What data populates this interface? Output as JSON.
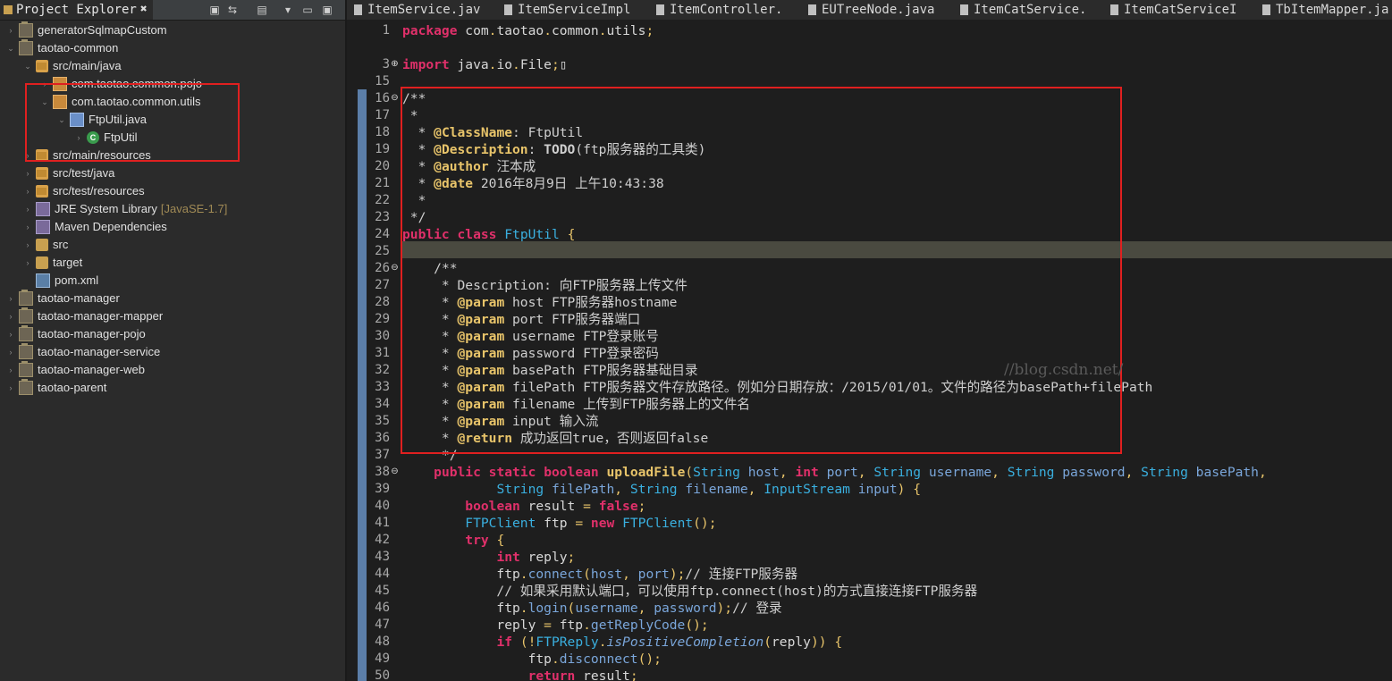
{
  "explorer": {
    "title": "Project Explorer",
    "close": "✖",
    "tree": [
      {
        "label": "generatorSqlmapCustom",
        "indent": 0,
        "icon": "project",
        "twisty": "›"
      },
      {
        "label": "taotao-common",
        "indent": 0,
        "icon": "project",
        "twisty": "⌄"
      },
      {
        "label": "src/main/java",
        "indent": 1,
        "icon": "srcfolder",
        "twisty": "⌄"
      },
      {
        "label": "com.taotao.common.pojo",
        "indent": 2,
        "icon": "package",
        "twisty": "›"
      },
      {
        "label": "com.taotao.common.utils",
        "indent": 2,
        "icon": "package",
        "twisty": "⌄"
      },
      {
        "label": "FtpUtil.java",
        "indent": 3,
        "icon": "java",
        "twisty": "⌄"
      },
      {
        "label": "FtpUtil",
        "indent": 4,
        "icon": "class",
        "twisty": "›"
      },
      {
        "label": "src/main/resources",
        "indent": 1,
        "icon": "srcfolder",
        "twisty": "›"
      },
      {
        "label": "src/test/java",
        "indent": 1,
        "icon": "srcfolder",
        "twisty": "›"
      },
      {
        "label": "src/test/resources",
        "indent": 1,
        "icon": "srcfolder",
        "twisty": "›"
      },
      {
        "label": "JRE System Library",
        "extra": "[JavaSE-1.7]",
        "indent": 1,
        "icon": "lib",
        "twisty": "›"
      },
      {
        "label": "Maven Dependencies",
        "indent": 1,
        "icon": "lib",
        "twisty": "›"
      },
      {
        "label": "src",
        "indent": 1,
        "icon": "folder",
        "twisty": "›"
      },
      {
        "label": "target",
        "indent": 1,
        "icon": "folder",
        "twisty": "›"
      },
      {
        "label": "pom.xml",
        "indent": 1,
        "icon": "xml",
        "twisty": ""
      },
      {
        "label": "taotao-manager",
        "indent": 0,
        "icon": "project",
        "twisty": "›"
      },
      {
        "label": "taotao-manager-mapper",
        "indent": 0,
        "icon": "project",
        "twisty": "›"
      },
      {
        "label": "taotao-manager-pojo",
        "indent": 0,
        "icon": "project",
        "twisty": "›"
      },
      {
        "label": "taotao-manager-service",
        "indent": 0,
        "icon": "project",
        "twisty": "›"
      },
      {
        "label": "taotao-manager-web",
        "indent": 0,
        "icon": "project",
        "twisty": "›"
      },
      {
        "label": "taotao-parent",
        "indent": 0,
        "icon": "project",
        "twisty": "›"
      }
    ]
  },
  "editor": {
    "tabs": [
      "ItemService.jav",
      "ItemServiceImpl",
      "ItemController.",
      "EUTreeNode.java",
      "ItemCatService.",
      "ItemCatServiceI",
      "TbItemMapper.ja"
    ],
    "watermark": "//blog.csdn.net/",
    "lines": [
      {
        "n": "1",
        "html": "<span class=\"kw\">package</span> com<span class=\"punc\">.</span>taotao<span class=\"punc\">.</span>common<span class=\"punc\">.</span>utils<span class=\"punc\">;</span>"
      },
      {
        "n": "",
        "html": ""
      },
      {
        "n": "3",
        "fold": "⊕",
        "html": "<span class=\"kw\">import</span> java<span class=\"punc\">.</span>io<span class=\"punc\">.</span>File<span class=\"punc\">;</span>▯"
      },
      {
        "n": "15",
        "html": ""
      },
      {
        "n": "16",
        "fold": "⊖",
        "html": "<span class=\"cm\">/**</span>"
      },
      {
        "n": "17",
        "html": "<span class=\"cm\"> *</span>"
      },
      {
        "n": "18",
        "html": "<span class=\"cm\">  * </span><span class=\"tag\">@ClassName</span><span class=\"cm\">: FtpUtil</span>"
      },
      {
        "n": "19",
        "html": "<span class=\"cm\">  * </span><span class=\"tag\">@Description</span><span class=\"cm\">: <b>TODO</b>(ftp服务器的工具类)</span>"
      },
      {
        "n": "20",
        "html": "<span class=\"cm\">  * </span><span class=\"tag\">@author</span><span class=\"cm\"> 汪本成</span>"
      },
      {
        "n": "21",
        "html": "<span class=\"cm\">  * </span><span class=\"tag\">@date</span><span class=\"cm\"> 2016年8月9日 上午10:43:38</span>"
      },
      {
        "n": "22",
        "html": "<span class=\"cm\">  *</span>"
      },
      {
        "n": "23",
        "html": "<span class=\"cm\"> */</span>"
      },
      {
        "n": "24",
        "html": "<span class=\"kw\">public</span> <span class=\"kw\">class</span> <span class=\"type\">FtpUtil</span> <span class=\"punc\">{</span>"
      },
      {
        "n": "25",
        "html": ""
      },
      {
        "n": "26",
        "fold": "⊖",
        "html": "    <span class=\"cm\">/**</span>"
      },
      {
        "n": "27",
        "html": "<span class=\"cm\">     * Description: 向FTP服务器上传文件</span>"
      },
      {
        "n": "28",
        "html": "<span class=\"cm\">     * </span><span class=\"tag\">@param</span><span class=\"cm\"> host FTP服务器hostname</span>"
      },
      {
        "n": "29",
        "html": "<span class=\"cm\">     * </span><span class=\"tag\">@param</span><span class=\"cm\"> port FTP服务器端口</span>"
      },
      {
        "n": "30",
        "html": "<span class=\"cm\">     * </span><span class=\"tag\">@param</span><span class=\"cm\"> username FTP登录账号</span>"
      },
      {
        "n": "31",
        "html": "<span class=\"cm\">     * </span><span class=\"tag\">@param</span><span class=\"cm\"> password FTP登录密码</span>"
      },
      {
        "n": "32",
        "html": "<span class=\"cm\">     * </span><span class=\"tag\">@param</span><span class=\"cm\"> basePath FTP服务器基础目录</span>"
      },
      {
        "n": "33",
        "html": "<span class=\"cm\">     * </span><span class=\"tag\">@param</span><span class=\"cm\"> filePath FTP服务器文件存放路径。例如分日期存放：/2015/01/01。文件的路径为basePath+filePath</span>"
      },
      {
        "n": "34",
        "html": "<span class=\"cm\">     * </span><span class=\"tag\">@param</span><span class=\"cm\"> filename 上传到FTP服务器上的文件名</span>"
      },
      {
        "n": "35",
        "html": "<span class=\"cm\">     * </span><span class=\"tag\">@param</span><span class=\"cm\"> input 输入流</span>"
      },
      {
        "n": "36",
        "html": "<span class=\"cm\">     * </span><span class=\"tag\">@return</span><span class=\"cm\"> 成功返回true，否则返回false</span>"
      },
      {
        "n": "37",
        "html": "<span class=\"cm\">     */</span>"
      },
      {
        "n": "38",
        "fold": "⊖",
        "html": "    <span class=\"kw\">public</span> <span class=\"kw\">static</span> <span class=\"kw\">boolean</span> <span class=\"method\">uploadFile</span><span class=\"punc\">(</span><span class=\"type\">String</span> <span class=\"param\">host</span><span class=\"punc\">,</span> <span class=\"kw\">int</span> <span class=\"param\">port</span><span class=\"punc\">,</span> <span class=\"type\">String</span> <span class=\"param\">username</span><span class=\"punc\">,</span> <span class=\"type\">String</span> <span class=\"param\">password</span><span class=\"punc\">,</span> <span class=\"type\">String</span> <span class=\"param\">basePath</span><span class=\"punc\">,</span>"
      },
      {
        "n": "39",
        "html": "            <span class=\"type\">String</span> <span class=\"param\">filePath</span><span class=\"punc\">,</span> <span class=\"type\">String</span> <span class=\"param\">filename</span><span class=\"punc\">,</span> <span class=\"type\">InputStream</span> <span class=\"param\">input</span><span class=\"punc\">)</span> <span class=\"punc\">{</span>"
      },
      {
        "n": "40",
        "html": "        <span class=\"kw\">boolean</span> result <span class=\"punc\">=</span> <span class=\"kw\">false</span><span class=\"punc\">;</span>"
      },
      {
        "n": "41",
        "html": "        <span class=\"type\">FTPClient</span> ftp <span class=\"punc\">=</span> <span class=\"kw\">new</span> <span class=\"type\">FTPClient</span><span class=\"punc\">();</span>"
      },
      {
        "n": "42",
        "html": "        <span class=\"kw\">try</span> <span class=\"punc\">{</span>"
      },
      {
        "n": "43",
        "html": "            <span class=\"kw\">int</span> reply<span class=\"punc\">;</span>"
      },
      {
        "n": "44",
        "html": "            ftp<span class=\"punc\">.</span><span class=\"param\">connect</span><span class=\"punc\">(</span><span class=\"param\">host</span><span class=\"punc\">,</span> <span class=\"param\">port</span><span class=\"punc\">);</span><span class=\"cm\">// 连接FTP服务器</span>"
      },
      {
        "n": "45",
        "html": "<span class=\"cm\">            // 如果采用默认端口，可以使用ftp.connect(host)的方式直接连接FTP服务器</span>"
      },
      {
        "n": "46",
        "html": "            ftp<span class=\"punc\">.</span><span class=\"param\">login</span><span class=\"punc\">(</span><span class=\"param\">username</span><span class=\"punc\">,</span> <span class=\"param\">password</span><span class=\"punc\">);</span><span class=\"cm\">// 登录</span>"
      },
      {
        "n": "47",
        "html": "            reply <span class=\"punc\">=</span> ftp<span class=\"punc\">.</span><span class=\"param\">getReplyCode</span><span class=\"punc\">();</span>"
      },
      {
        "n": "48",
        "html": "            <span class=\"kw\">if</span> <span class=\"punc\">(!</span><span class=\"type\">FTPReply</span><span class=\"punc\">.</span><span class=\"param italic\">isPositiveCompletion</span><span class=\"punc\">(</span>reply<span class=\"punc\">))</span> <span class=\"punc\">{</span>"
      },
      {
        "n": "49",
        "html": "                ftp<span class=\"punc\">.</span><span class=\"param\">disconnect</span><span class=\"punc\">();</span>"
      },
      {
        "n": "50",
        "html": "                <span class=\"kw\">return</span> result<span class=\"punc\">;</span>"
      }
    ]
  }
}
